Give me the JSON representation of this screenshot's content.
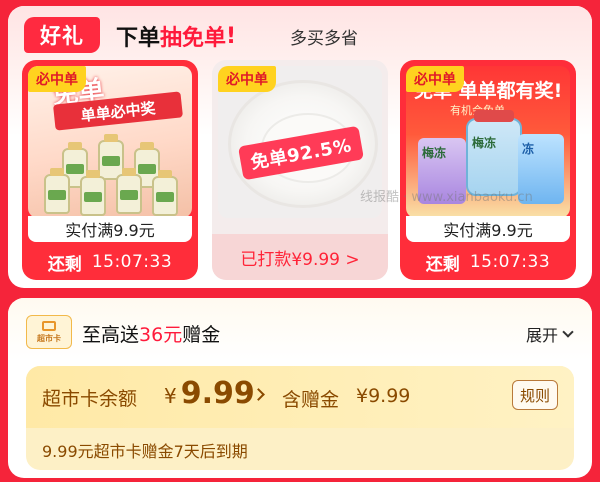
{
  "header": {
    "badge": "好礼",
    "title_prefix": "下单",
    "title_highlight": "抽免单",
    "title_mark": "!",
    "subtitle": "多买多省"
  },
  "products": [
    {
      "tag": "必中单",
      "image_text_big": "免单",
      "image_text_ribbon": "单单必中奖",
      "pay_text": "实付满9.9元",
      "remain_label": "还剩",
      "remain_time": "15:07:33"
    },
    {
      "tag": "必中单",
      "stamp": "免单92.5%",
      "status": "已打款¥9.99 >"
    },
    {
      "tag": "必中单",
      "image_text_head": "免单 单单都有奖!",
      "image_text_sub": "有机会免单",
      "bag_text_1": "梅冻",
      "bag_text_2": "梅冻",
      "bag_text_3": "冻",
      "pay_text": "实付满9.9元",
      "remain_label": "还剩",
      "remain_time": "15:07:33"
    }
  ],
  "watermark": "线报酷 · www.xianbaoku.cn",
  "gift": {
    "icon_text": "超市卡",
    "title_prefix": "至高送",
    "title_amount": "36元",
    "title_suffix": "赠金",
    "expand_label": "展开",
    "balance_label": "超市卡余额",
    "balance_currency": "¥",
    "balance_value": "9.99",
    "gift_label": "含赠金",
    "gift_value": "¥9.99",
    "rule_label": "规则",
    "expire_text": "9.99元超市卡赠金7天后到期"
  },
  "colors": {
    "page_red": "#f5243a",
    "accent_red": "#ff1a3b",
    "tag_yellow": "#ffd21f",
    "gold_text": "#8a4a00"
  }
}
